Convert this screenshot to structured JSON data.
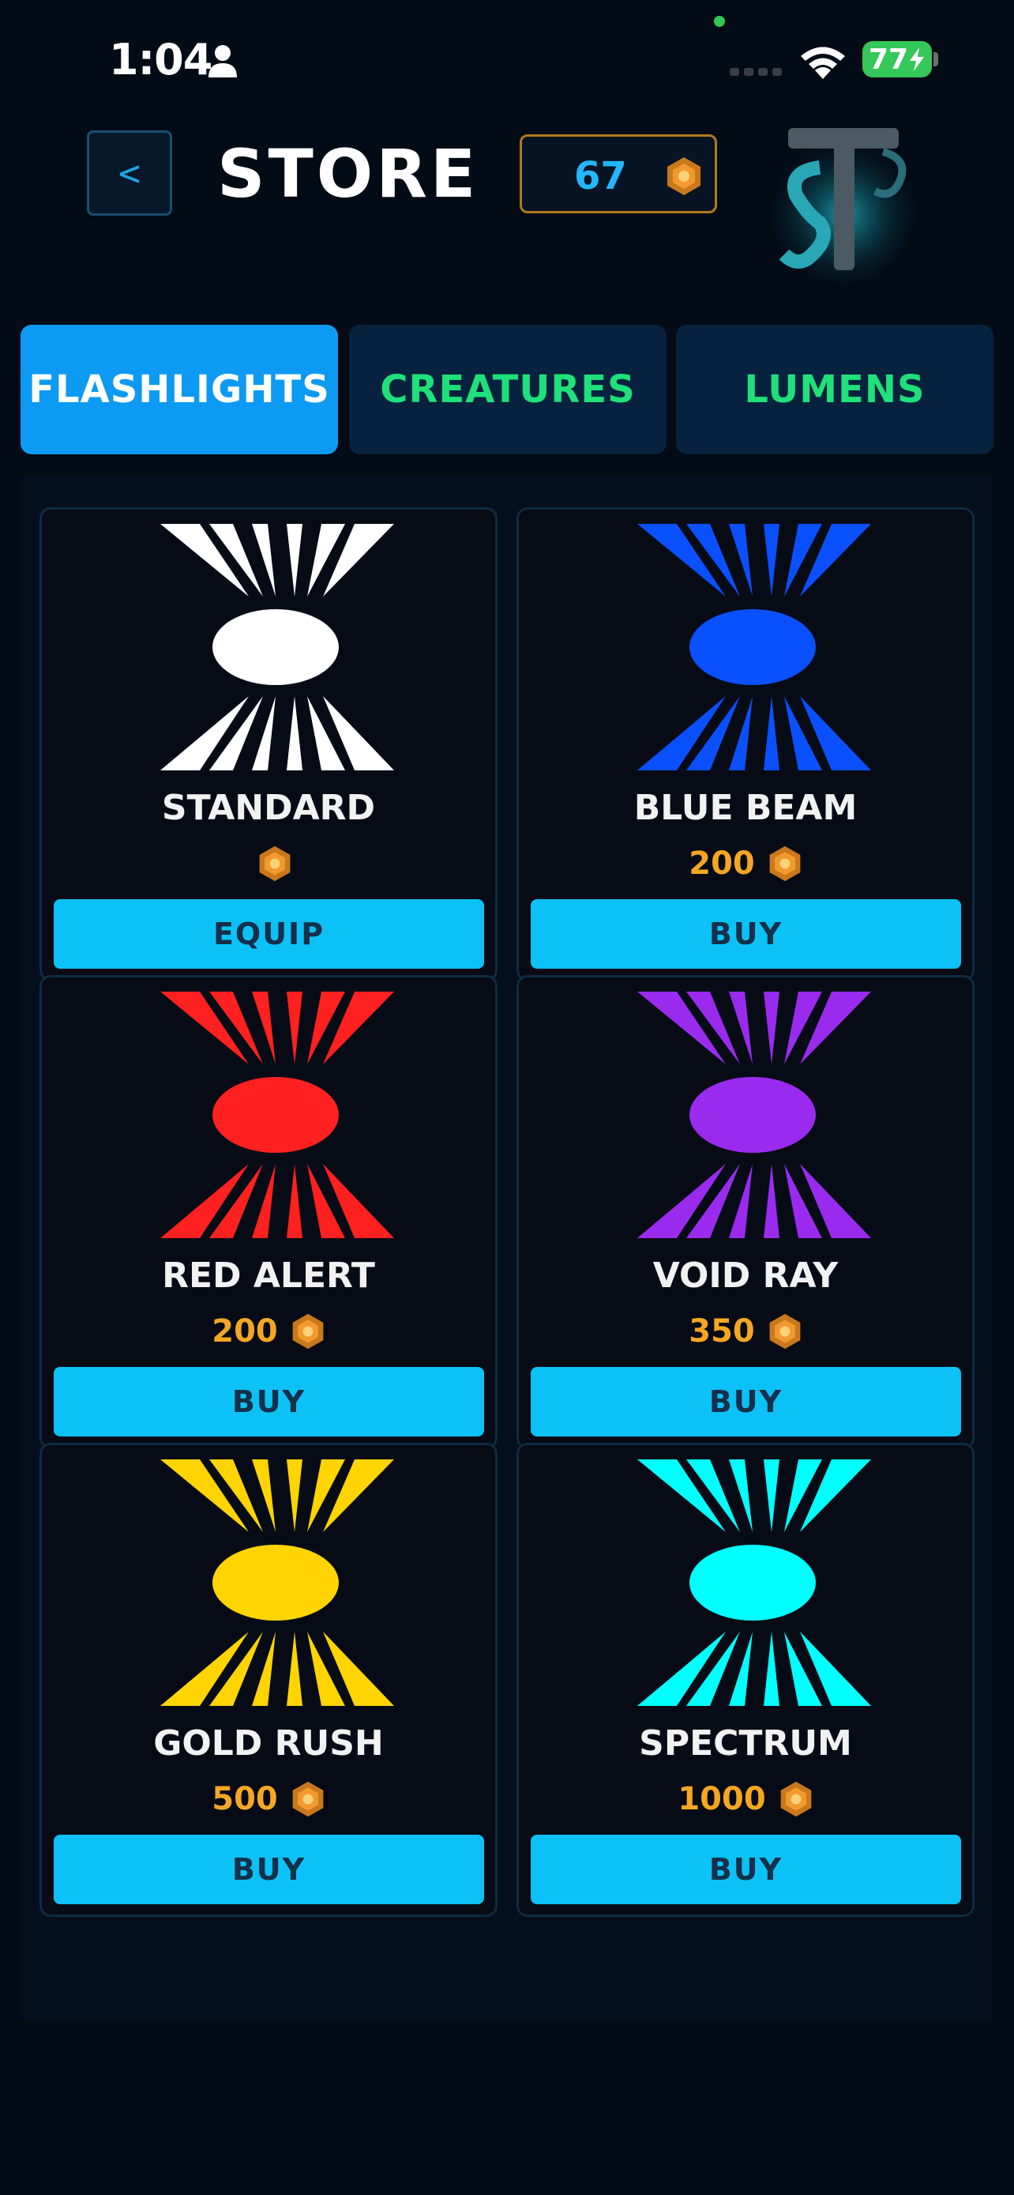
{
  "status_bar": {
    "time": "1:04",
    "battery": "77",
    "icons": [
      "person-icon",
      "signal-icon",
      "wifi-icon",
      "battery-charging-icon"
    ]
  },
  "header": {
    "back_label": "<",
    "title": "STORE",
    "coin_balance": "67",
    "coin_icon": "lumen-coin-icon",
    "logo_icon": "st-dragon-logo"
  },
  "tabs": [
    {
      "label": "FLASHLIGHTS",
      "active": true
    },
    {
      "label": "CREATURES",
      "active": false
    },
    {
      "label": "LUMENS",
      "active": false
    }
  ],
  "items": [
    {
      "name": "STANDARD",
      "price": "",
      "action": "EQUIP",
      "color": "#ffffff"
    },
    {
      "name": "BLUE BEAM",
      "price": "200",
      "action": "BUY",
      "color": "#0a50ff"
    },
    {
      "name": "RED ALERT",
      "price": "200",
      "action": "BUY",
      "color": "#ff2020"
    },
    {
      "name": "VOID RAY",
      "price": "350",
      "action": "BUY",
      "color": "#9a2bee"
    },
    {
      "name": "GOLD RUSH",
      "price": "500",
      "action": "BUY",
      "color": "#ffd400"
    },
    {
      "name": "SPECTRUM",
      "price": "1000",
      "action": "BUY",
      "color": "#00ffff"
    }
  ],
  "colors": {
    "accent_blue": "#0d9af3",
    "button_cyan": "#0cc1f5",
    "tab_text_green": "#1fe07a",
    "price_orange": "#f5a623"
  }
}
